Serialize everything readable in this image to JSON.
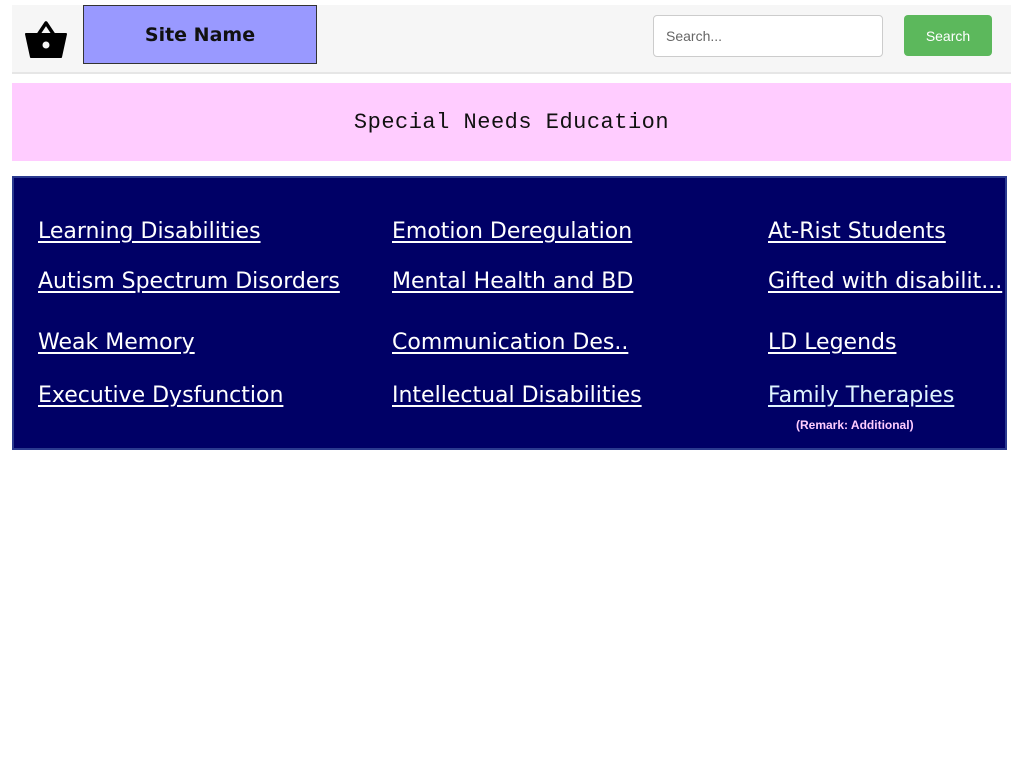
{
  "header": {
    "basket_icon": "shopping-basket-icon",
    "site_name": "Site Name",
    "search": {
      "placeholder": "Search...",
      "value": "",
      "button_label": "Search"
    }
  },
  "banner": {
    "title": "Special Needs Education"
  },
  "nav": {
    "links": [
      {
        "label": "Learning Disabilities"
      },
      {
        "label": "Emotion Deregulation"
      },
      {
        "label": "At-Rist Students"
      },
      {
        "label": "Autism Spectrum Disorders"
      },
      {
        "label": "Mental Health and BD"
      },
      {
        "label": "Gifted with disabilit..."
      },
      {
        "label": "Weak Memory"
      },
      {
        "label": "Communication Des.."
      },
      {
        "label": "LD Legends"
      },
      {
        "label": "Executive Dysfunction"
      },
      {
        "label": "Intellectual Disabilities"
      },
      {
        "label": "Family Therapies"
      }
    ],
    "remark": "(Remark: Additional)"
  },
  "colors": {
    "header_bg": "#f6f6f6",
    "site_name_bg": "#9999ff",
    "search_button": "#5cb85c",
    "banner_bg": "#ffccff",
    "nav_bg": "#000066",
    "remark_text": "#ffccff"
  }
}
